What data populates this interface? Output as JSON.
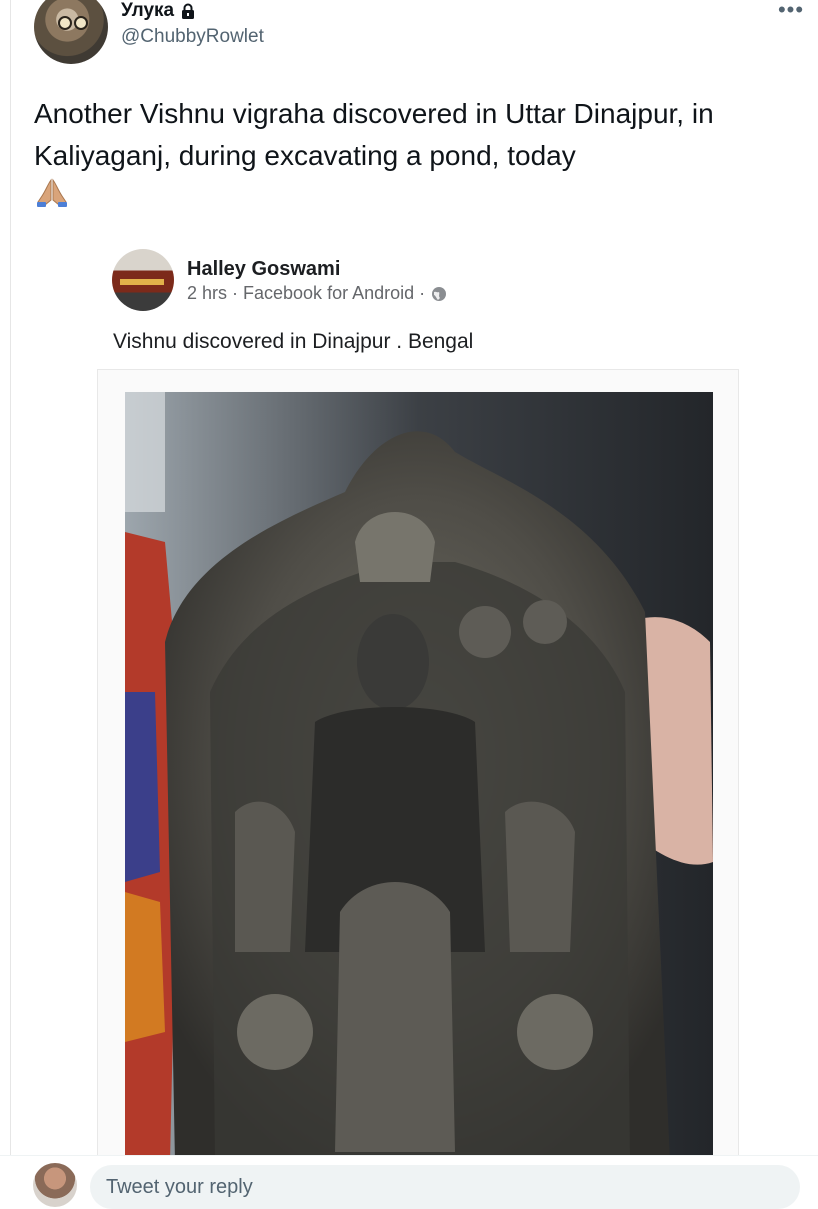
{
  "tweet": {
    "display_name": "Улука",
    "handle": "@ChubbyRowlet",
    "text": "Another Vishnu vigraha discovered in Uttar Dinajpur, in Kaliyaganj, during excavating a pond, today",
    "emoji": "folded-hands-icon",
    "more": "more-options-icon"
  },
  "embedded_post": {
    "author": "Halley Goswami",
    "meta": "2 hrs · Facebook for Android ·",
    "text": "Vishnu discovered in Dinajpur . Bengal"
  },
  "reply": {
    "placeholder": "Tweet your reply"
  },
  "colors": {
    "text_primary": "#0f1419",
    "text_secondary": "#536471",
    "reply_bg": "#eff3f4"
  }
}
